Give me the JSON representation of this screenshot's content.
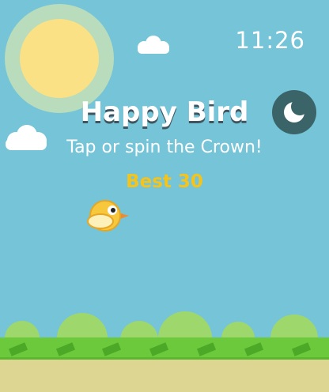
{
  "status": {
    "time": "11:26"
  },
  "game": {
    "title": "Happy Bird",
    "instruction": "Tap or spin the Crown!",
    "best_score": "Best 30"
  },
  "controls": {
    "theme_toggle_icon": "moon-icon"
  },
  "colors": {
    "sky": "#75c4d8",
    "grass": "#6cc93b",
    "ground": "#ddd693",
    "sun": "#fbe185",
    "bird": "#f7c83c",
    "best_score": "#f4c41d",
    "theme_button": "#3b6469"
  }
}
